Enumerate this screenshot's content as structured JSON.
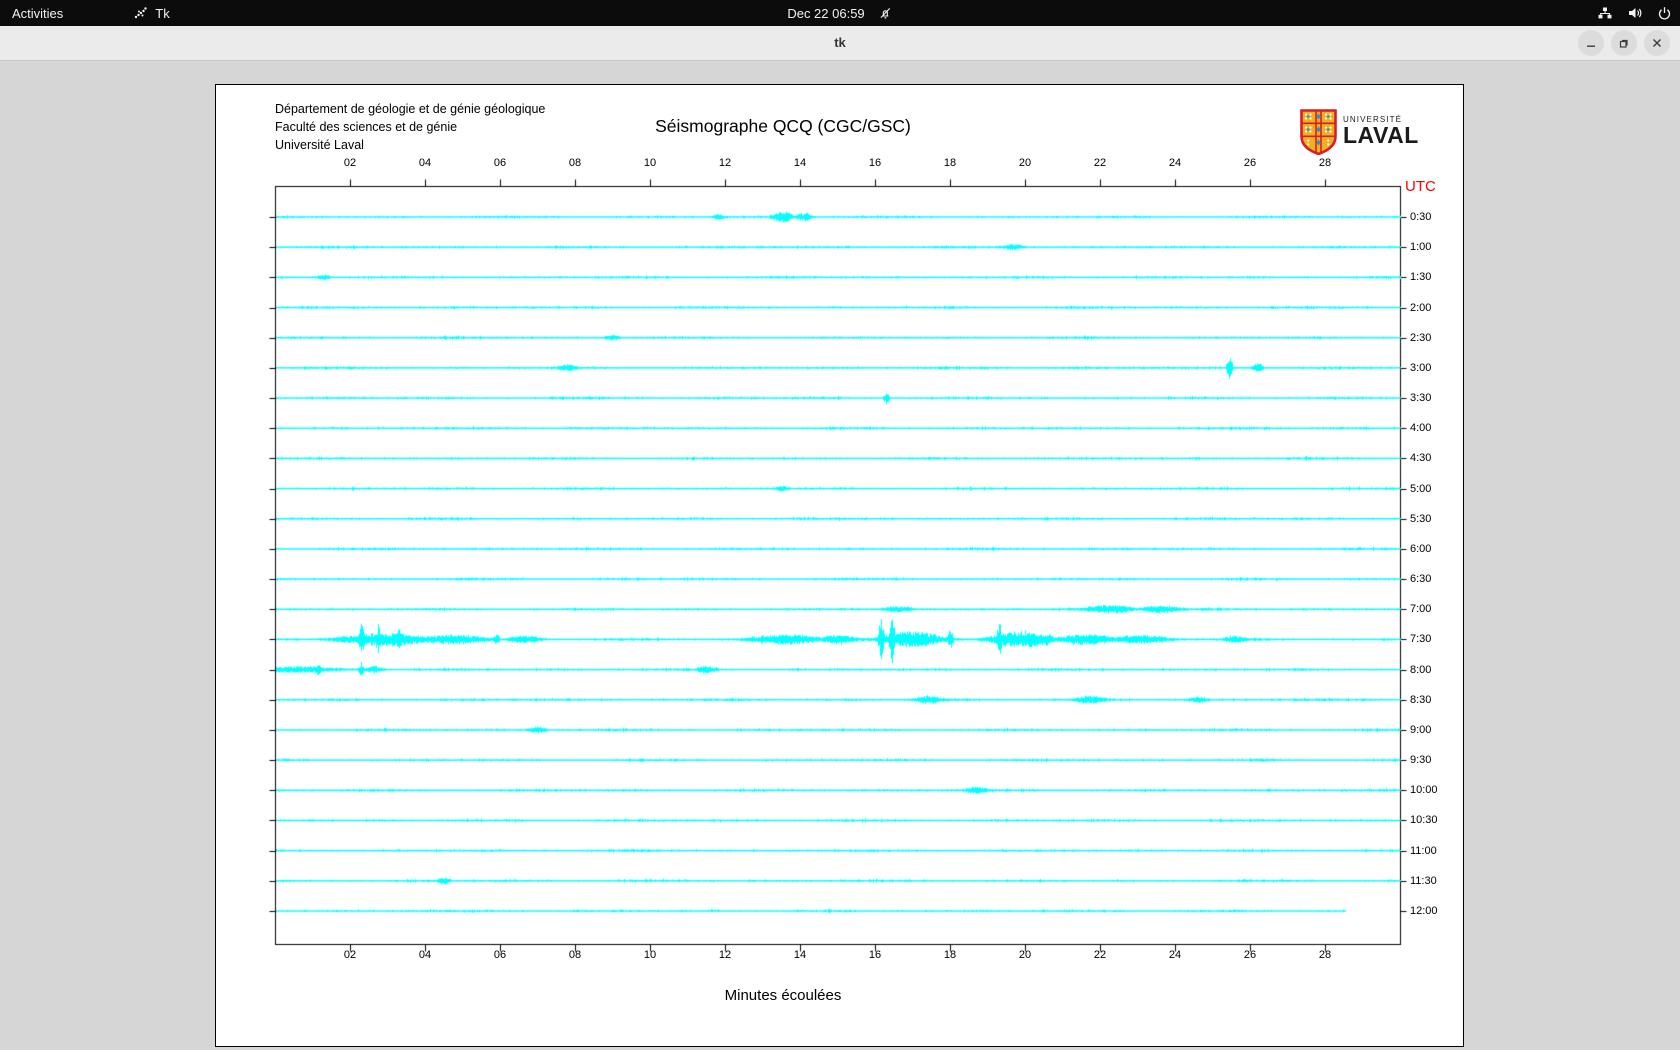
{
  "topbar": {
    "activities": "Activities",
    "app": "Tk",
    "clock": "Dec 22 06:59"
  },
  "titlebar": {
    "title": "tk"
  },
  "panel": {
    "org_lines": [
      "Département de géologie et de génie géologique",
      "Faculté des sciences et de génie",
      "Université Laval"
    ],
    "logo": {
      "small": "UNIVERSITÉ",
      "big": "LAVAL"
    }
  },
  "chart_data": {
    "type": "line",
    "title": "Séismographe QCQ (CGC/GSC)",
    "xlabel": "Minutes écoulées",
    "y_axis_label": "UTC",
    "x_range": [
      0,
      30
    ],
    "x_ticks": [
      "02",
      "04",
      "06",
      "08",
      "10",
      "12",
      "14",
      "16",
      "18",
      "20",
      "22",
      "24",
      "26",
      "28"
    ],
    "trace_color": "#00ffff",
    "utc_label_color": "#ff0000",
    "grid": false,
    "legend": "none",
    "noise_seed": 1342,
    "rows": [
      {
        "label": "0:30",
        "events": [
          {
            "t": 11.8,
            "dur": 0.25,
            "amp": 3
          },
          {
            "t": 13.55,
            "dur": 0.5,
            "amp": 5
          },
          {
            "t": 14.1,
            "dur": 0.4,
            "amp": 4
          }
        ]
      },
      {
        "label": "1:00",
        "events": [
          {
            "t": 19.7,
            "dur": 0.5,
            "amp": 3
          }
        ]
      },
      {
        "label": "1:30",
        "events": [
          {
            "t": 1.3,
            "dur": 0.3,
            "amp": 2.5
          }
        ]
      },
      {
        "label": "2:00",
        "events": []
      },
      {
        "label": "2:30",
        "events": [
          {
            "t": 9.0,
            "dur": 0.3,
            "amp": 2.5
          }
        ]
      },
      {
        "label": "3:00",
        "events": [
          {
            "t": 7.8,
            "dur": 0.4,
            "amp": 3
          },
          {
            "t": 25.45,
            "amp": 14,
            "spike": true
          },
          {
            "t": 26.2,
            "dur": 0.25,
            "amp": 5
          }
        ]
      },
      {
        "label": "3:30",
        "events": [
          {
            "t": 16.3,
            "amp": 7,
            "spike": true
          }
        ]
      },
      {
        "label": "4:00",
        "events": []
      },
      {
        "label": "4:30",
        "events": []
      },
      {
        "label": "5:00",
        "events": [
          {
            "t": 13.5,
            "dur": 0.3,
            "amp": 2.5
          }
        ]
      },
      {
        "label": "5:30",
        "events": []
      },
      {
        "label": "6:00",
        "events": []
      },
      {
        "label": "6:30",
        "events": []
      },
      {
        "label": "7:00",
        "events": [
          {
            "t": 16.6,
            "dur": 0.7,
            "amp": 3
          },
          {
            "t": 22.3,
            "dur": 1.2,
            "amp": 4
          },
          {
            "t": 23.6,
            "dur": 0.9,
            "amp": 3.5
          }
        ]
      },
      {
        "label": "7:30",
        "events": [
          {
            "t": 2.3,
            "amp": 19,
            "spike": true
          },
          {
            "t": 2.75,
            "amp": 16,
            "spike": true
          },
          {
            "t": 3.3,
            "amp": 13,
            "spike": true
          },
          {
            "t": 2.9,
            "dur": 2.2,
            "amp": 6
          },
          {
            "t": 4.7,
            "dur": 1.6,
            "amp": 4.5
          },
          {
            "t": 5.9,
            "amp": 6,
            "spike": true
          },
          {
            "t": 6.7,
            "dur": 0.8,
            "amp": 3.5
          },
          {
            "t": 13.6,
            "dur": 1.6,
            "amp": 5
          },
          {
            "t": 15.0,
            "dur": 0.8,
            "amp": 4
          },
          {
            "t": 16.15,
            "amp": 24,
            "spike": true
          },
          {
            "t": 16.45,
            "amp": 27,
            "spike": true
          },
          {
            "t": 17.0,
            "dur": 1.4,
            "amp": 8
          },
          {
            "t": 18.0,
            "amp": 11,
            "spike": true
          },
          {
            "t": 19.3,
            "amp": 22,
            "spike": true
          },
          {
            "t": 19.9,
            "dur": 1.4,
            "amp": 8
          },
          {
            "t": 20.6,
            "amp": 9,
            "spike": true
          },
          {
            "t": 21.6,
            "dur": 1.4,
            "amp": 5
          },
          {
            "t": 23.1,
            "dur": 1.4,
            "amp": 4
          },
          {
            "t": 25.6,
            "dur": 0.5,
            "amp": 3
          }
        ]
      },
      {
        "label": "8:00",
        "events": [
          {
            "t": 0.6,
            "dur": 2.0,
            "amp": 2.5
          },
          {
            "t": 1.15,
            "amp": 6,
            "spike": true
          },
          {
            "t": 2.3,
            "amp": 8,
            "spike": true
          },
          {
            "t": 2.65,
            "dur": 0.4,
            "amp": 3.5
          },
          {
            "t": 11.5,
            "dur": 0.4,
            "amp": 3.5
          }
        ]
      },
      {
        "label": "8:30",
        "events": [
          {
            "t": 17.4,
            "dur": 0.6,
            "amp": 3.5
          },
          {
            "t": 21.7,
            "dur": 0.7,
            "amp": 3.5
          },
          {
            "t": 24.6,
            "dur": 0.4,
            "amp": 3
          }
        ]
      },
      {
        "label": "9:00",
        "events": [
          {
            "t": 7.0,
            "dur": 0.4,
            "amp": 3
          }
        ]
      },
      {
        "label": "9:30",
        "events": []
      },
      {
        "label": "10:00",
        "events": [
          {
            "t": 18.7,
            "dur": 0.5,
            "amp": 3
          }
        ]
      },
      {
        "label": "10:30",
        "events": []
      },
      {
        "label": "11:00",
        "events": []
      },
      {
        "label": "11:30",
        "events": [
          {
            "t": 4.5,
            "dur": 0.3,
            "amp": 3
          }
        ]
      },
      {
        "label": "12:00",
        "end_minute": 28.55,
        "events": []
      }
    ]
  }
}
